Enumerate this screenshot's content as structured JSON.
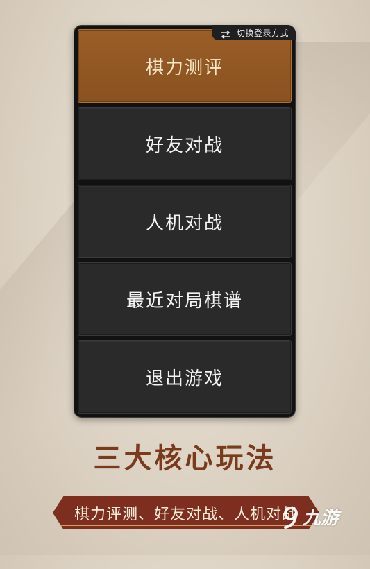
{
  "header": {
    "switch_login_label": "切换登录方式",
    "switch_icon": "swap-arrows-icon"
  },
  "menu": {
    "items": [
      {
        "label": "棋力测评",
        "active": true
      },
      {
        "label": "好友对战",
        "active": false
      },
      {
        "label": "人机对战",
        "active": false
      },
      {
        "label": "最近对局棋谱",
        "active": false
      },
      {
        "label": "退出游戏",
        "active": false
      }
    ]
  },
  "promo": {
    "headline": "三大核心玩法",
    "ribbon_text": "棋力评测、好友对战、人机对战"
  },
  "watermark": {
    "text": "九游",
    "logo_icon": "nine-game-logo-icon"
  },
  "colors": {
    "active_item": "#8e5522",
    "inactive_item": "#2a2a2a",
    "headline": "#7a3a1c",
    "ribbon": "#7d2e1f"
  }
}
